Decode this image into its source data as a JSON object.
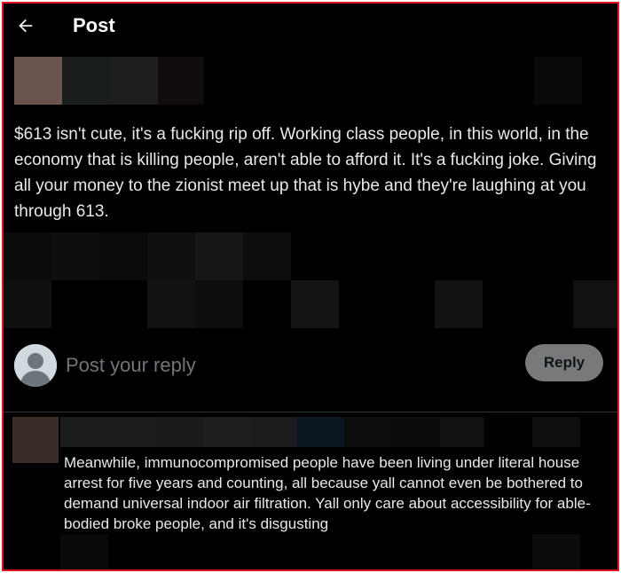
{
  "header": {
    "title": "Post",
    "back_icon": "arrow-left-icon"
  },
  "post": {
    "text": "$613 isn't cute, it's a fucking rip off. Working class people, in this world, in the economy that is killing people, aren't able to afford it. It's a fucking joke. Giving all your money to the zionist meet up that is hybe and they're laughing at you through 613."
  },
  "compose": {
    "placeholder": "Post your reply",
    "reply_label": "Reply"
  },
  "reply": {
    "text": "Meanwhile, immunocompromised people have been living under literal house arrest for five years and counting, all because yall cannot even be bothered to demand universal indoor air filtration.  Yall only care about accessibility for able-bodied broke people, and it's disgusting"
  },
  "colors": {
    "background": "#000000",
    "text": "#e7e9ea",
    "muted": "#71767b",
    "reply_button": "#787a7a",
    "frame_border": "#e0141e"
  }
}
